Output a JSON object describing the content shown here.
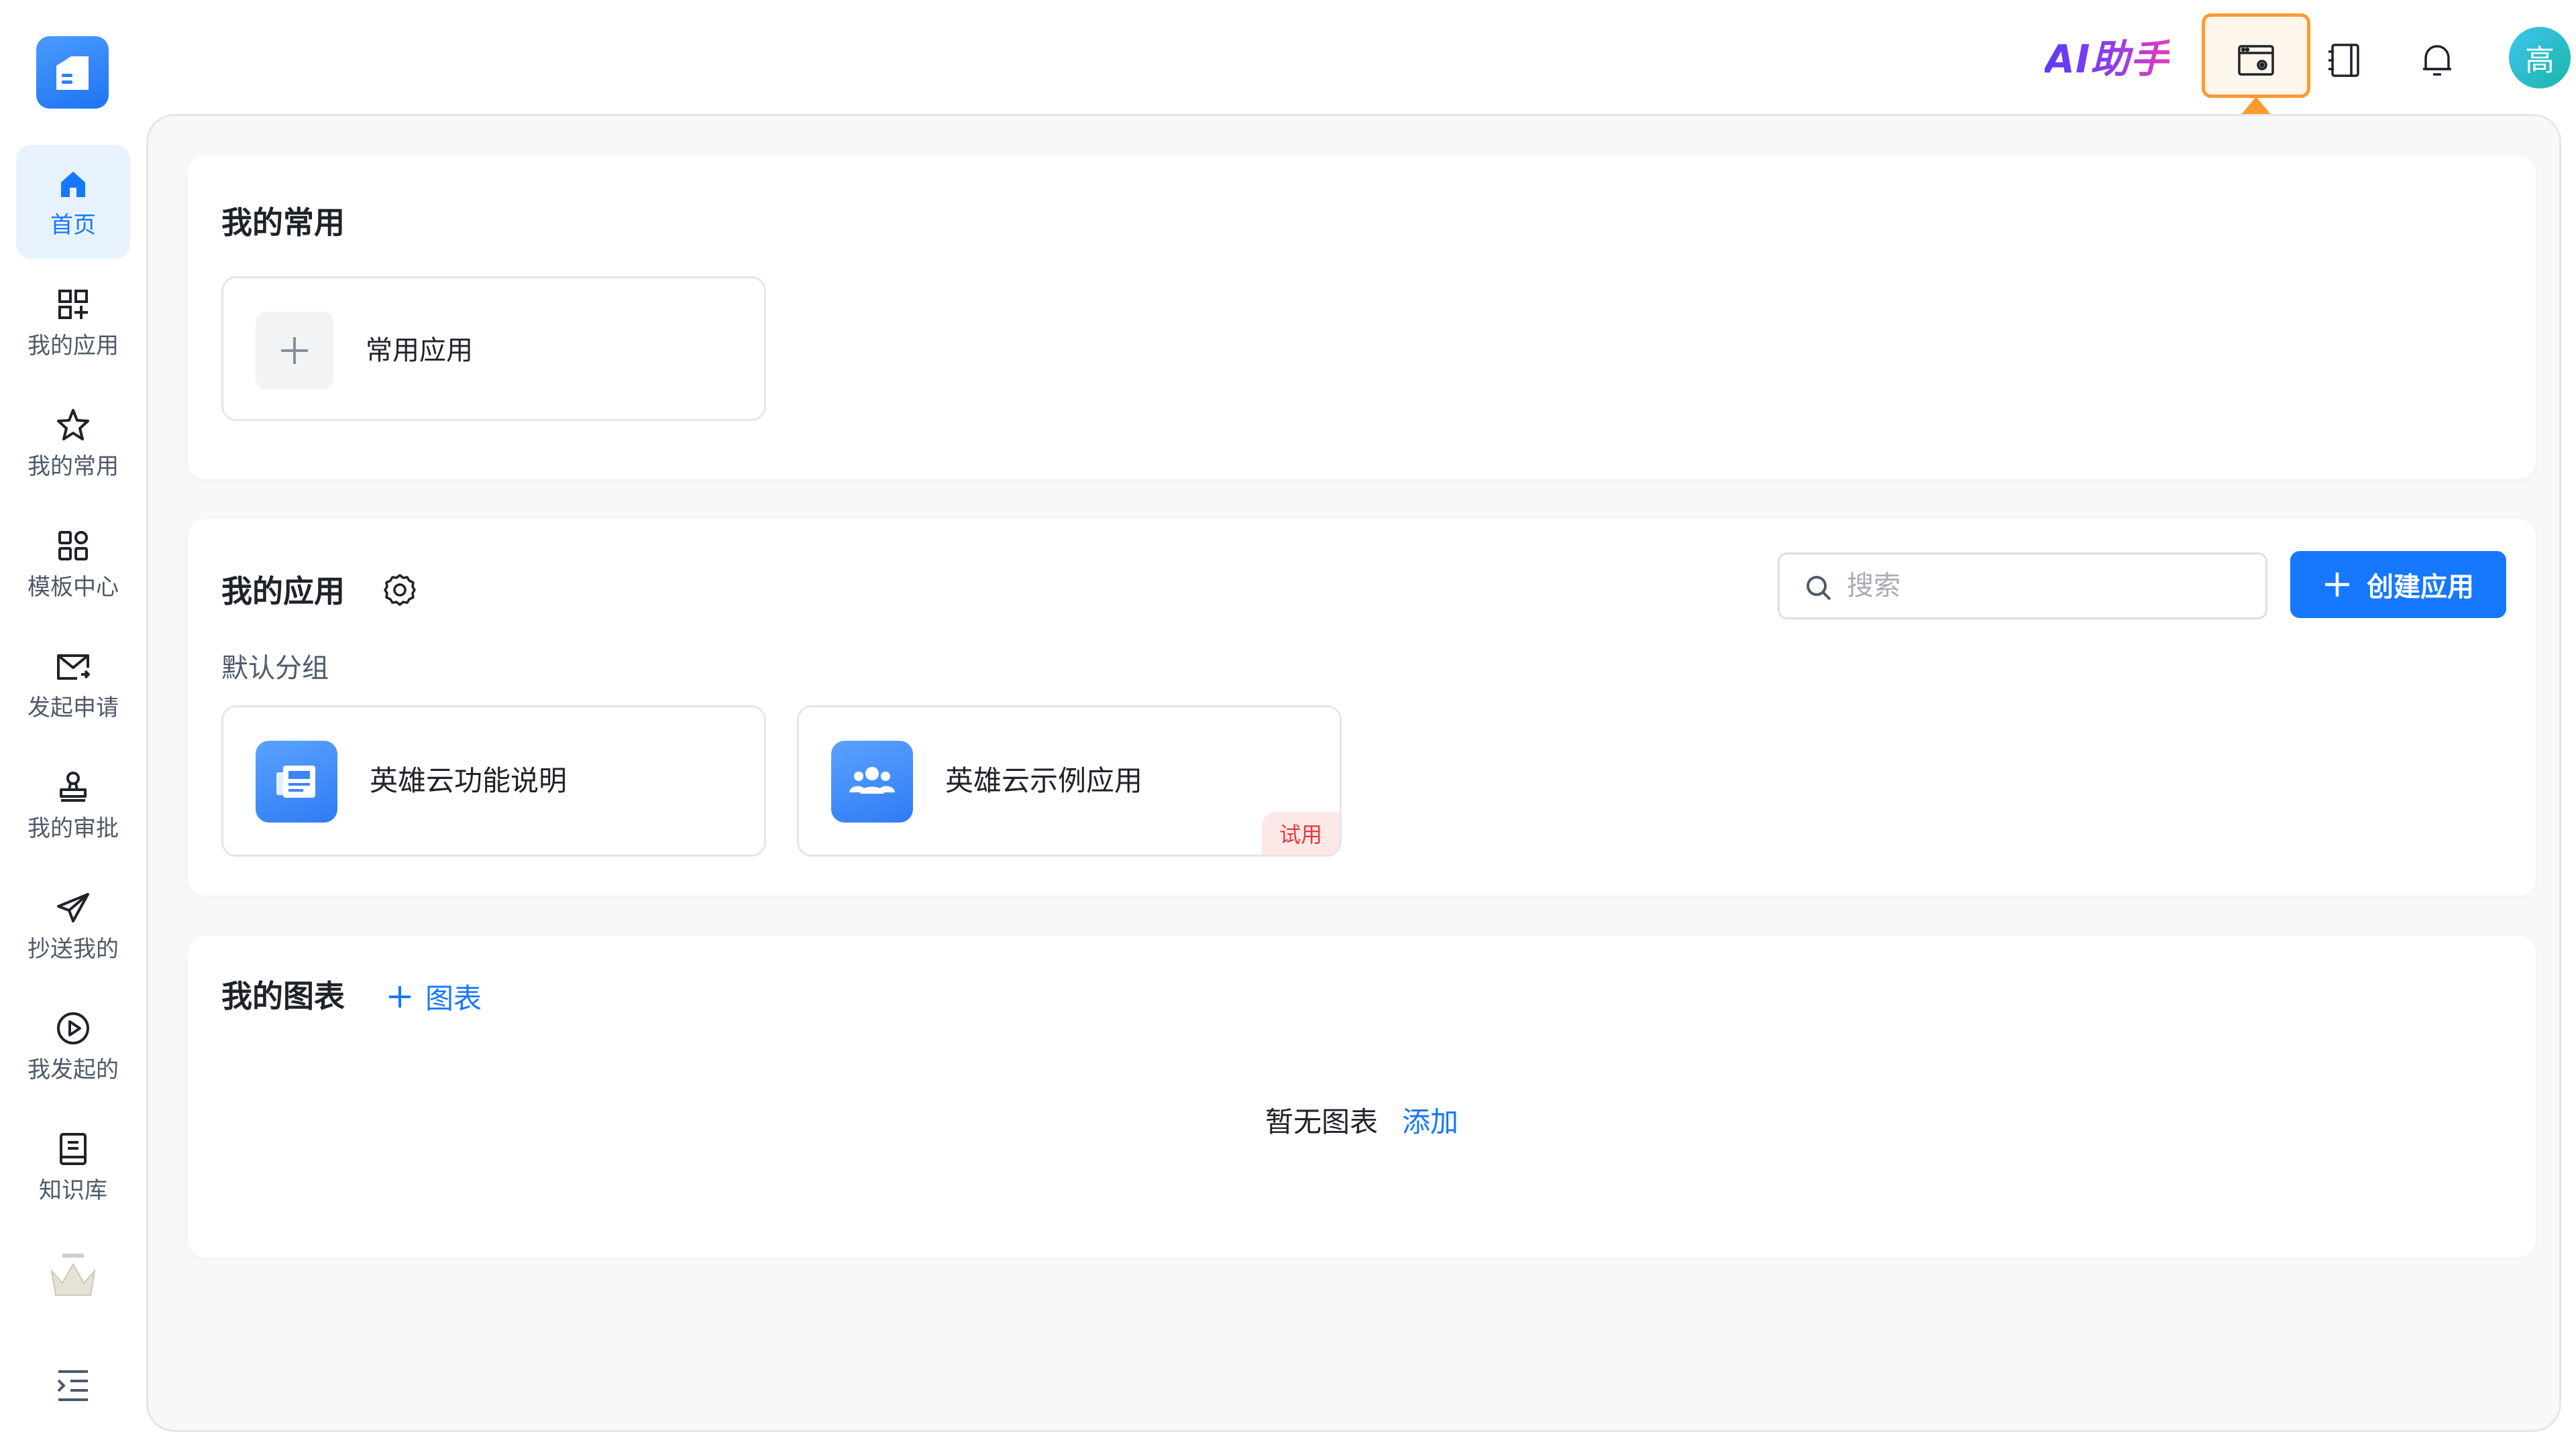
{
  "topbar": {
    "ai_assistant_label": "AI助手",
    "avatar_text": "高"
  },
  "sidebar": {
    "items": [
      {
        "label": "首页",
        "icon": "home-icon"
      },
      {
        "label": "我的应用",
        "icon": "apps-add-icon"
      },
      {
        "label": "我的常用",
        "icon": "star-icon"
      },
      {
        "label": "模板中心",
        "icon": "template-grid-icon"
      },
      {
        "label": "发起申请",
        "icon": "mail-send-icon"
      },
      {
        "label": "我的审批",
        "icon": "stamp-icon"
      },
      {
        "label": "抄送我的",
        "icon": "paper-plane-icon"
      },
      {
        "label": "我发起的",
        "icon": "play-circle-icon"
      },
      {
        "label": "知识库",
        "icon": "book-icon"
      }
    ],
    "active_index": 0
  },
  "favorites": {
    "title": "我的常用",
    "add_label": "常用应用"
  },
  "apps": {
    "title": "我的应用",
    "search_placeholder": "搜索",
    "create_label": "创建应用",
    "group_label": "默认分组",
    "cards": [
      {
        "name": "英雄云功能说明",
        "icon": "news-doc-icon",
        "badge": ""
      },
      {
        "name": "英雄云示例应用",
        "icon": "users-group-icon",
        "badge": "试用"
      }
    ]
  },
  "charts": {
    "title": "我的图表",
    "add_label": "图表",
    "empty_text": "暂无图表",
    "empty_link": "添加"
  },
  "colors": {
    "primary": "#1677ff",
    "highlight": "#ff9a2f",
    "trial_badge": "#e8383d"
  }
}
